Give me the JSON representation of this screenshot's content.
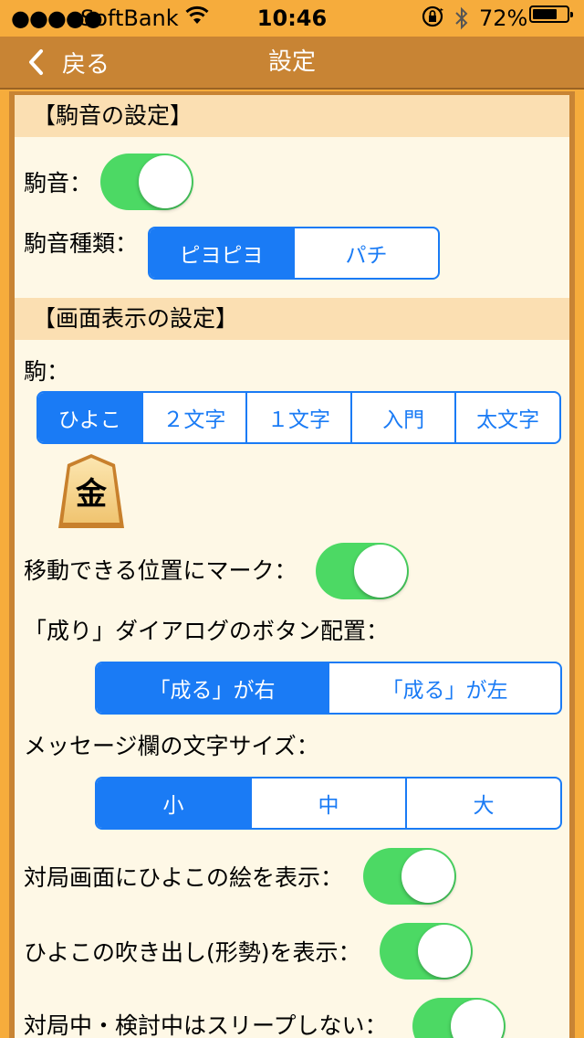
{
  "status_bar": {
    "signal": "●●●●●",
    "carrier": "SoftBank",
    "time": "10:46",
    "battery_percent": "72%",
    "battery_level": 0.72
  },
  "navbar": {
    "back_label": "戻る",
    "title": "設定"
  },
  "sections": {
    "sound": {
      "header": "【駒音の設定】",
      "sound_label": "駒音：",
      "sound_on": true,
      "sound_type_label": "駒音種類：",
      "sound_type_options": [
        "ピヨピヨ",
        "パチ"
      ],
      "sound_type_selected": "ピヨピヨ"
    },
    "display": {
      "header": "【画面表示の設定】",
      "piece_label": "駒：",
      "piece_options": [
        "ひよこ",
        "２文字",
        "１文字",
        "入門",
        "太文字"
      ],
      "piece_selected": "ひよこ",
      "piece_preview": "金",
      "mark_label": "移動できる位置にマーク：",
      "mark_on": true,
      "promote_label": "「成り」ダイアログのボタン配置：",
      "promote_options": [
        "「成る」が右",
        "「成る」が左"
      ],
      "promote_selected": "「成る」が右",
      "msg_size_label": "メッセージ欄の文字サイズ：",
      "msg_size_options": [
        "小",
        "中",
        "大"
      ],
      "msg_size_selected": "小",
      "chick_label": "対局画面にひよこの絵を表示：",
      "chick_on": true,
      "bubble_label": "ひよこの吹き出し(形勢)を表示：",
      "bubble_on": true,
      "sleep_label": "対局中・検討中はスリープしない：",
      "sleep_on": true
    }
  },
  "colors": {
    "accent": "#1a7bf5",
    "toggle_on": "#4cd964",
    "navbar": "#c88434",
    "statusbar": "#f6ac3c",
    "section_header": "#fbdfb2",
    "panel": "#fef8e6"
  }
}
